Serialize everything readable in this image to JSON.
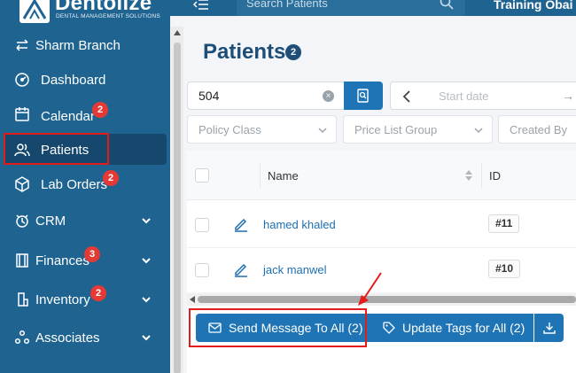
{
  "brand": {
    "name": "Dentolize",
    "tagline": "DENTAL MANAGEMENT SOLUTIONS"
  },
  "header": {
    "search_placeholder": "Search Patients",
    "user_label": "Training Obai"
  },
  "sidebar": {
    "branch_label": "Sharm Branch",
    "items": [
      {
        "label": "Dashboard",
        "icon": "dashboard-icon"
      },
      {
        "label": "Calendar",
        "icon": "calendar-icon",
        "badge": "2"
      },
      {
        "label": "Patients",
        "icon": "patients-icon",
        "active": true
      },
      {
        "label": "Lab Orders",
        "icon": "lab-orders-icon",
        "badge": "2"
      },
      {
        "label": "CRM",
        "icon": "crm-icon",
        "expandable": true
      },
      {
        "label": "Finances",
        "icon": "finances-icon",
        "badge": "3",
        "expandable": true
      },
      {
        "label": "Inventory",
        "icon": "inventory-icon",
        "badge": "2",
        "expandable": true
      },
      {
        "label": "Associates",
        "icon": "associates-icon",
        "expandable": true
      }
    ]
  },
  "main": {
    "title": "Patients",
    "title_badge": "2",
    "search": {
      "value": "504"
    },
    "date": {
      "start_placeholder": "Start date",
      "arrow": "→"
    },
    "filters": [
      "Policy Class",
      "Price List Group",
      "Created By"
    ],
    "table": {
      "columns": [
        "Name",
        "ID"
      ],
      "rows": [
        {
          "name": "hamed khaled",
          "id": "#11"
        },
        {
          "name": "jack manwel",
          "id": "#10"
        }
      ]
    },
    "actions": {
      "send_message": "Send Message To All (2)",
      "update_tags": "Update Tags for All (2)"
    }
  },
  "colors": {
    "sidebar": "#1f6491",
    "primary_button": "#1e74b5",
    "badge": "#e53935",
    "highlight": "#e31b1b",
    "link": "#1e6fb0"
  }
}
